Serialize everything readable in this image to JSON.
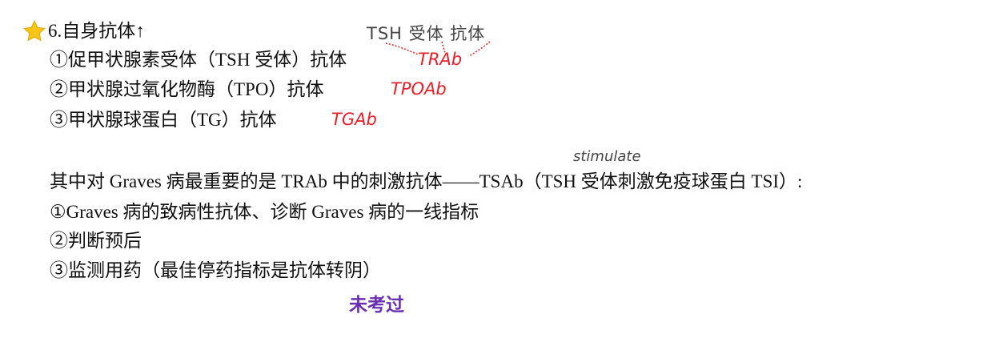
{
  "heading": {
    "text": "6.自身抗体↑",
    "icon": "star-icon",
    "icon_color": "#f5c518"
  },
  "antibodies": [
    {
      "label": "①促甲状腺素受体（TSH 受体）抗体",
      "note": "TRAb"
    },
    {
      "label": "②甲状腺过氧化物酶（TPO）抗体",
      "note": "TPOAb"
    },
    {
      "label": "③甲状腺球蛋白（TG）抗体",
      "note": "TGAb"
    }
  ],
  "annotation_top": "TSH 受体 抗体",
  "annotation_stimulate": "stimulate",
  "summary": "其中对 Graves 病最重要的是 TRAb 中的刺激抗体——TSAb（TSH 受体刺激免疫球蛋白 TSI）:",
  "uses": [
    "①Graves 病的致病性抗体、诊断 Graves 病的一线指标",
    "②判断预后",
    "③监测用药（最佳停药指标是抗体转阴）"
  ],
  "annotation_bottom": "未考过",
  "colors": {
    "red_ink": "#e8202a",
    "gray_ink": "#444444",
    "purple_ink": "#6a2fb0"
  }
}
